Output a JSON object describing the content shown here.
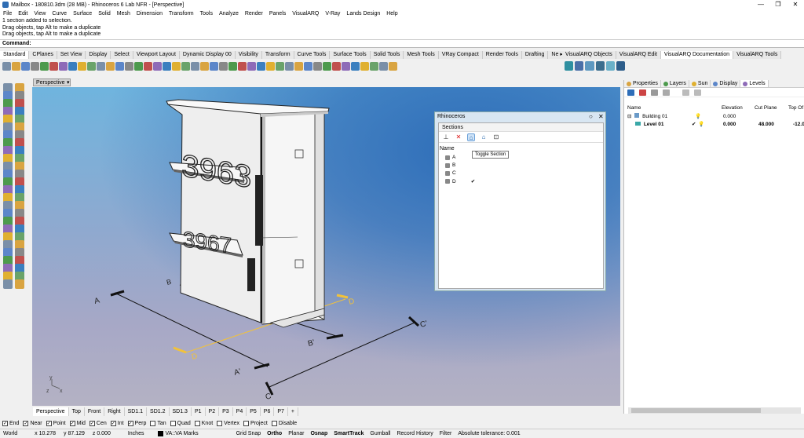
{
  "window": {
    "title": "Mailbox - 180810.3dm (28 MB) - Rhinoceros 6 Lab NFR - [Perspective]",
    "min_glyph": "—",
    "max_glyph": "❐",
    "close_glyph": "✕"
  },
  "menu": [
    "File",
    "Edit",
    "View",
    "Curve",
    "Surface",
    "Solid",
    "Mesh",
    "Dimension",
    "Transform",
    "Tools",
    "Analyze",
    "Render",
    "Panels",
    "VisualARQ",
    "V-Ray",
    "Lands Design",
    "Help"
  ],
  "command_history": [
    "1 section added to selection.",
    "Drag objects, tap Alt to make a duplicate",
    "Drag objects, tap Alt to make a duplicate"
  ],
  "command_prompt": "Command:",
  "toolbar_tabs": [
    "Standard",
    "CPlanes",
    "Set View",
    "Display",
    "Select",
    "Viewport Layout",
    "Dynamic Display 00",
    "Visibility",
    "Transform",
    "Curve Tools",
    "Surface Tools",
    "Solid Tools",
    "Mesh Tools",
    "VRay Compact",
    "Render Tools",
    "Drafting",
    "Ne ▸"
  ],
  "toolbar_tabs_right": [
    "VisualARQ Objects",
    "VisualARQ Edit",
    "VisualARQ Documentation",
    "VisualARQ Tools"
  ],
  "toolbar_tabs_right_active": 2,
  "viewport": {
    "label": "Perspective",
    "dropdown_glyph": "▾",
    "numbers": [
      "3963",
      "3967"
    ],
    "section_labels": {
      "a1": "A",
      "a2": "A'",
      "b1": "B",
      "b2": "B'",
      "c1": "C",
      "c2": "C'",
      "d1": "D",
      "d2": "D"
    },
    "axis": {
      "y": "y",
      "x": "x",
      "z": "z"
    }
  },
  "rhino_dialog": {
    "title": "Rhinoceros",
    "panel_title": "Sections",
    "name_header": "Name",
    "tooltip": "Toggle Section",
    "sections": [
      {
        "name": "A",
        "checked": ""
      },
      {
        "name": "B",
        "checked": ""
      },
      {
        "name": "C",
        "checked": ""
      },
      {
        "name": "D",
        "checked": "✔"
      }
    ]
  },
  "right_panel": {
    "tabs": [
      "Properties",
      "Layers",
      "Sun",
      "Display",
      "Levels"
    ],
    "active_tab": 4,
    "columns": [
      "Name",
      "Elevation",
      "Cut Plane",
      "Top Of"
    ],
    "rows": [
      {
        "name": "Building 01",
        "elevation": "0.000",
        "cut_plane": "",
        "top": ""
      },
      {
        "name": "Level 01",
        "elevation": "0.000",
        "cut_plane": "48.000",
        "top": "-12.0"
      }
    ]
  },
  "viewport_tabs": [
    "Perspective",
    "Top",
    "Front",
    "Right",
    "SD1.1",
    "SD1.2",
    "SD1.3",
    "P1",
    "P2",
    "P3",
    "P4",
    "P5",
    "P6",
    "P7",
    "+"
  ],
  "osnaps": [
    {
      "label": "End",
      "checked": true
    },
    {
      "label": "Near",
      "checked": true
    },
    {
      "label": "Point",
      "checked": true
    },
    {
      "label": "Mid",
      "checked": true
    },
    {
      "label": "Cen",
      "checked": true
    },
    {
      "label": "Int",
      "checked": true
    },
    {
      "label": "Perp",
      "checked": true
    },
    {
      "label": "Tan",
      "checked": false
    },
    {
      "label": "Quad",
      "checked": false
    },
    {
      "label": "Knot",
      "checked": false
    },
    {
      "label": "Vertex",
      "checked": false
    },
    {
      "label": "Project",
      "checked": false
    },
    {
      "label": "Disable",
      "checked": false
    }
  ],
  "status": {
    "cplane": "World",
    "x": "x 10.278",
    "y": "y 87.129",
    "z": "z 0.000",
    "units": "Inches",
    "layer": "VA::VA Marks",
    "grid_snap": "Grid Snap",
    "ortho": "Ortho",
    "planar": "Planar",
    "osnap": "Osnap",
    "smarttrack": "SmartTrack",
    "gumball": "Gumball",
    "record_history": "Record History",
    "filter": "Filter",
    "tolerance": "Absolute tolerance: 0.001"
  },
  "colors": {
    "accent": "#2d6db8",
    "yellow_section": "#f2c23a"
  }
}
